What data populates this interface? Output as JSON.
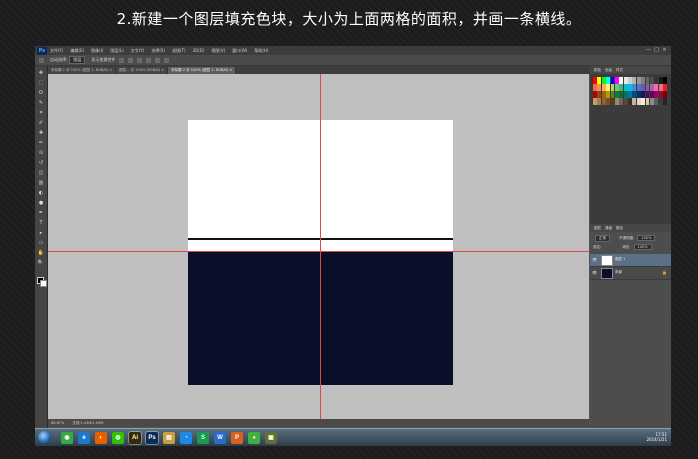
{
  "caption": "2.新建一个图层填充色块，大小为上面两格的面积，并画一条横线。",
  "app": {
    "logo": "Ps",
    "menus": [
      "文件(F)",
      "编辑(E)",
      "图像(I)",
      "图层(L)",
      "文字(Y)",
      "选择(S)",
      "滤镜(T)",
      "3D(D)",
      "视图(V)",
      "窗口(W)",
      "帮助(H)"
    ],
    "window_controls": [
      "—",
      "□",
      "×"
    ]
  },
  "options_bar": {
    "tool_label": "自动选择:",
    "tool_select": "图层",
    "show_transform": "显示变换控件"
  },
  "tabs": [
    {
      "label": "未标题-1 @ 100% (图层 1, RGB/8) ×",
      "active": false
    },
    {
      "label": "图层... @ 100% (RGB/8) ×",
      "active": false
    },
    {
      "label": "未标题-2 @ 100% (图层 1, RGB/8) ×",
      "active": true
    }
  ],
  "tools": [
    "move-tool",
    "marquee-tool",
    "lasso-tool",
    "quick-select-tool",
    "crop-tool",
    "eyedropper-tool",
    "healing-brush-tool",
    "brush-tool",
    "clone-stamp-tool",
    "history-brush-tool",
    "eraser-tool",
    "gradient-tool",
    "blur-tool",
    "dodge-tool",
    "pen-tool",
    "type-tool",
    "path-select-tool",
    "shape-tool",
    "hand-tool",
    "zoom-tool"
  ],
  "tool_glyphs": [
    "✥",
    "⬚",
    "ʘ",
    "✎",
    "⌗",
    "✐",
    "✚",
    "✏",
    "⊙",
    "↺",
    "◫",
    "▥",
    "◐",
    "●",
    "✒",
    "T",
    "▸",
    "▭",
    "✋",
    "🔍"
  ],
  "canvas": {
    "top_color": "#ffffff",
    "bottom_color": "#0b0e29",
    "line_color": "#111111",
    "guide_color": "#e0484a"
  },
  "status": {
    "zoom": "66.67%",
    "doc_size": "文档:1.43M/1.09M"
  },
  "panels": {
    "color_tabs": [
      "颜色",
      "色板",
      "样式"
    ],
    "swatch_colors": [
      "#ff0000",
      "#ffff00",
      "#00ff00",
      "#00ffff",
      "#0000ff",
      "#ff00ff",
      "#ffffff",
      "#e6e6e6",
      "#cccccc",
      "#b3b3b3",
      "#999999",
      "#808080",
      "#666666",
      "#4d4d4d",
      "#333333",
      "#1a1a1a",
      "#000000",
      "#f26c4f",
      "#f68e55",
      "#fbaf5c",
      "#fff467",
      "#acd372",
      "#7cc576",
      "#3bb878",
      "#1abbb4",
      "#00bff3",
      "#438ccb",
      "#5574b9",
      "#605ca8",
      "#855fa8",
      "#a763a8",
      "#f06ea9",
      "#f26d7d",
      "#ed1c24",
      "#9e0b0f",
      "#a0410d",
      "#a36209",
      "#aba000",
      "#598527",
      "#1a7b30",
      "#007236",
      "#00746b",
      "#0076a3",
      "#004b80",
      "#003471",
      "#1b1464",
      "#440e62",
      "#630460",
      "#9e005d",
      "#9e0039",
      "#790000",
      "#c69c6d",
      "#a67c52",
      "#8c6239",
      "#754c24",
      "#603913",
      "#998675",
      "#736357",
      "#534741",
      "#362f2d",
      "#c7b299",
      "#e2d7c5",
      "#f4ead7",
      "#d9c9a3",
      "#8c8c8c",
      "#5e5e5e",
      "#3a3a3a",
      "#252525"
    ],
    "layers_tabs": [
      "图层",
      "通道",
      "路径"
    ],
    "blend_mode": "正常",
    "opacity_label": "不透明度:",
    "opacity": "100%",
    "lock_label": "锁定:",
    "fill_label": "填充:",
    "fill": "100%",
    "layers": [
      {
        "name": "图层 1",
        "thumb": "#ffffff",
        "selected": true
      },
      {
        "name": "背景",
        "thumb": "#0b0e29",
        "selected": false
      }
    ],
    "eye_glyph": "👁",
    "lock_glyph": "🔒"
  },
  "taskbar": {
    "icons": [
      {
        "name": "chrome-icon",
        "glyph": "◉",
        "color": "#3aa845",
        "running": false
      },
      {
        "name": "ie-icon",
        "glyph": "e",
        "color": "#1e78c8",
        "running": false
      },
      {
        "name": "firefox-icon",
        "glyph": "◐",
        "color": "#e66000",
        "running": false
      },
      {
        "name": "wechat-icon",
        "glyph": "◍",
        "color": "#2dc100",
        "running": false
      },
      {
        "name": "illustrator-icon",
        "glyph": "Ai",
        "color": "#3a2a00",
        "running": true
      },
      {
        "name": "photoshop-icon",
        "glyph": "Ps",
        "color": "#0a2a5a",
        "running": true
      },
      {
        "name": "explorer-icon",
        "glyph": "▤",
        "color": "#c8a040",
        "running": false
      },
      {
        "name": "qq-icon",
        "glyph": "◔",
        "color": "#1e88e5",
        "running": false
      },
      {
        "name": "spreadsheet-icon",
        "glyph": "S",
        "color": "#1a9a50",
        "running": false
      },
      {
        "name": "writer-icon",
        "glyph": "W",
        "color": "#2a6cc8",
        "running": false
      },
      {
        "name": "presentation-icon",
        "glyph": "P",
        "color": "#d86020",
        "running": false
      },
      {
        "name": "game-icon",
        "glyph": "◕",
        "color": "#40b040",
        "running": false
      },
      {
        "name": "picture-icon",
        "glyph": "▣",
        "color": "#607030",
        "running": false
      }
    ],
    "time": "17:51",
    "date": "2014/1/21"
  }
}
